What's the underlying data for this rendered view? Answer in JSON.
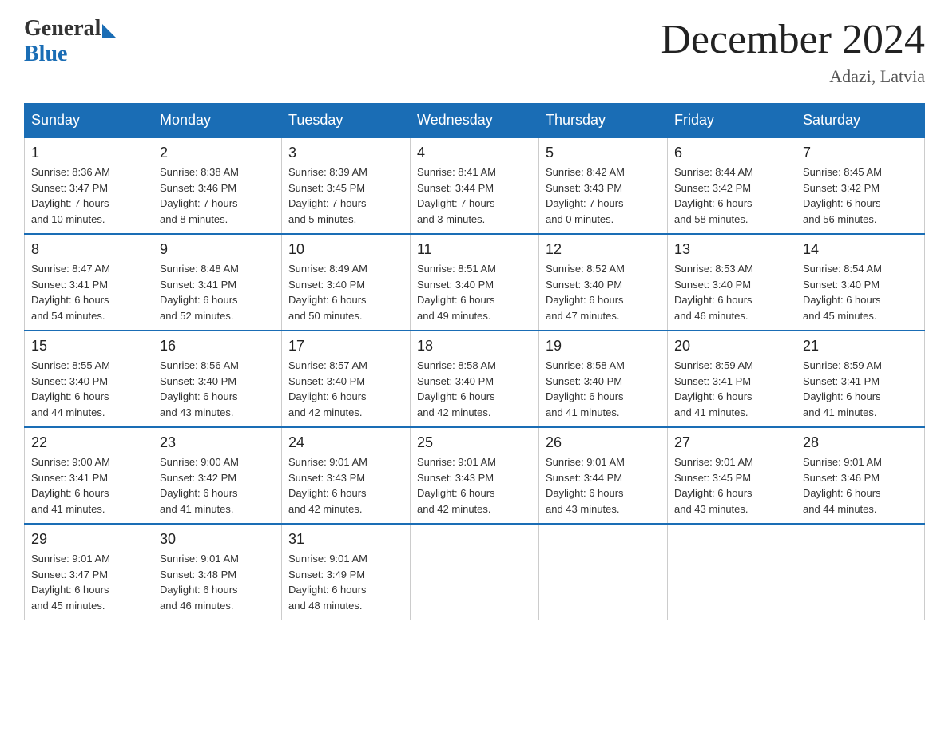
{
  "header": {
    "logo_general": "General",
    "logo_blue": "Blue",
    "month_title": "December 2024",
    "location": "Adazi, Latvia"
  },
  "days_of_week": [
    "Sunday",
    "Monday",
    "Tuesday",
    "Wednesday",
    "Thursday",
    "Friday",
    "Saturday"
  ],
  "weeks": [
    [
      {
        "day": "1",
        "sunrise": "8:36 AM",
        "sunset": "3:47 PM",
        "daylight": "7 hours and 10 minutes."
      },
      {
        "day": "2",
        "sunrise": "8:38 AM",
        "sunset": "3:46 PM",
        "daylight": "7 hours and 8 minutes."
      },
      {
        "day": "3",
        "sunrise": "8:39 AM",
        "sunset": "3:45 PM",
        "daylight": "7 hours and 5 minutes."
      },
      {
        "day": "4",
        "sunrise": "8:41 AM",
        "sunset": "3:44 PM",
        "daylight": "7 hours and 3 minutes."
      },
      {
        "day": "5",
        "sunrise": "8:42 AM",
        "sunset": "3:43 PM",
        "daylight": "7 hours and 0 minutes."
      },
      {
        "day": "6",
        "sunrise": "8:44 AM",
        "sunset": "3:42 PM",
        "daylight": "6 hours and 58 minutes."
      },
      {
        "day": "7",
        "sunrise": "8:45 AM",
        "sunset": "3:42 PM",
        "daylight": "6 hours and 56 minutes."
      }
    ],
    [
      {
        "day": "8",
        "sunrise": "8:47 AM",
        "sunset": "3:41 PM",
        "daylight": "6 hours and 54 minutes."
      },
      {
        "day": "9",
        "sunrise": "8:48 AM",
        "sunset": "3:41 PM",
        "daylight": "6 hours and 52 minutes."
      },
      {
        "day": "10",
        "sunrise": "8:49 AM",
        "sunset": "3:40 PM",
        "daylight": "6 hours and 50 minutes."
      },
      {
        "day": "11",
        "sunrise": "8:51 AM",
        "sunset": "3:40 PM",
        "daylight": "6 hours and 49 minutes."
      },
      {
        "day": "12",
        "sunrise": "8:52 AM",
        "sunset": "3:40 PM",
        "daylight": "6 hours and 47 minutes."
      },
      {
        "day": "13",
        "sunrise": "8:53 AM",
        "sunset": "3:40 PM",
        "daylight": "6 hours and 46 minutes."
      },
      {
        "day": "14",
        "sunrise": "8:54 AM",
        "sunset": "3:40 PM",
        "daylight": "6 hours and 45 minutes."
      }
    ],
    [
      {
        "day": "15",
        "sunrise": "8:55 AM",
        "sunset": "3:40 PM",
        "daylight": "6 hours and 44 minutes."
      },
      {
        "day": "16",
        "sunrise": "8:56 AM",
        "sunset": "3:40 PM",
        "daylight": "6 hours and 43 minutes."
      },
      {
        "day": "17",
        "sunrise": "8:57 AM",
        "sunset": "3:40 PM",
        "daylight": "6 hours and 42 minutes."
      },
      {
        "day": "18",
        "sunrise": "8:58 AM",
        "sunset": "3:40 PM",
        "daylight": "6 hours and 42 minutes."
      },
      {
        "day": "19",
        "sunrise": "8:58 AM",
        "sunset": "3:40 PM",
        "daylight": "6 hours and 41 minutes."
      },
      {
        "day": "20",
        "sunrise": "8:59 AM",
        "sunset": "3:41 PM",
        "daylight": "6 hours and 41 minutes."
      },
      {
        "day": "21",
        "sunrise": "8:59 AM",
        "sunset": "3:41 PM",
        "daylight": "6 hours and 41 minutes."
      }
    ],
    [
      {
        "day": "22",
        "sunrise": "9:00 AM",
        "sunset": "3:41 PM",
        "daylight": "6 hours and 41 minutes."
      },
      {
        "day": "23",
        "sunrise": "9:00 AM",
        "sunset": "3:42 PM",
        "daylight": "6 hours and 41 minutes."
      },
      {
        "day": "24",
        "sunrise": "9:01 AM",
        "sunset": "3:43 PM",
        "daylight": "6 hours and 42 minutes."
      },
      {
        "day": "25",
        "sunrise": "9:01 AM",
        "sunset": "3:43 PM",
        "daylight": "6 hours and 42 minutes."
      },
      {
        "day": "26",
        "sunrise": "9:01 AM",
        "sunset": "3:44 PM",
        "daylight": "6 hours and 43 minutes."
      },
      {
        "day": "27",
        "sunrise": "9:01 AM",
        "sunset": "3:45 PM",
        "daylight": "6 hours and 43 minutes."
      },
      {
        "day": "28",
        "sunrise": "9:01 AM",
        "sunset": "3:46 PM",
        "daylight": "6 hours and 44 minutes."
      }
    ],
    [
      {
        "day": "29",
        "sunrise": "9:01 AM",
        "sunset": "3:47 PM",
        "daylight": "6 hours and 45 minutes."
      },
      {
        "day": "30",
        "sunrise": "9:01 AM",
        "sunset": "3:48 PM",
        "daylight": "6 hours and 46 minutes."
      },
      {
        "day": "31",
        "sunrise": "9:01 AM",
        "sunset": "3:49 PM",
        "daylight": "6 hours and 48 minutes."
      },
      null,
      null,
      null,
      null
    ]
  ]
}
